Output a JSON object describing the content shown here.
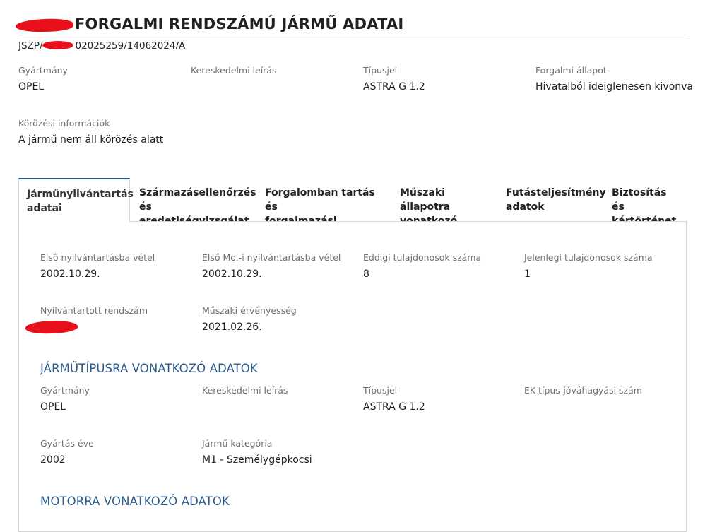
{
  "header": {
    "title": "FORGALMI RENDSZÁMÚ JÁRMŰ ADATAI",
    "ref_prefix": "JSZP/",
    "ref_suffix": "02025259/14062024/A"
  },
  "summary": [
    {
      "label": "Gyártmány",
      "value": "OPEL"
    },
    {
      "label": "Kereskedelmi leírás",
      "value": ""
    },
    {
      "label": "Típusjel",
      "value": "ASTRA G 1.2"
    },
    {
      "label": "Forgalmi állapot",
      "value": "Hivatalból ideiglenesen kivonva"
    },
    {
      "label": "Körözési információk",
      "value": "A jármű nem áll körözés alatt"
    }
  ],
  "tabs": [
    {
      "line1": "Járműnyilvántartás",
      "line2": "adatai",
      "active": true
    },
    {
      "line1": "Származásellenőrzés",
      "line2": "és eredetiségvizsgálat",
      "active": false
    },
    {
      "line1": "Forgalomban tartás és",
      "line2": "forgalmazási korlátozás",
      "active": false
    },
    {
      "line1": "Műszaki állapotra",
      "line2": "vonatkozó adatok",
      "active": false
    },
    {
      "line1": "Futásteljesítmény",
      "line2": "adatok",
      "active": false
    },
    {
      "line1": "Biztosítás és",
      "line2": "kártörténet",
      "active": false
    }
  ],
  "registry": [
    {
      "label": "Első nyilvántartásba vétel",
      "value": "2002.10.29."
    },
    {
      "label": "Első Mo.-i nyilvántartásba vétel",
      "value": "2002.10.29."
    },
    {
      "label": "Eddigi tulajdonosok száma",
      "value": "8"
    },
    {
      "label": "Jelenlegi tulajdonosok száma",
      "value": "1"
    },
    {
      "label": "Nyilvántartott rendszám",
      "value": ""
    },
    {
      "label": "Műszaki érvényesség",
      "value": "2021.02.26."
    }
  ],
  "type_section": {
    "heading": "JÁRMŰTÍPUSRA VONATKOZÓ ADATOK",
    "fields": [
      {
        "label": "Gyártmány",
        "value": "OPEL"
      },
      {
        "label": "Kereskedelmi leírás",
        "value": ""
      },
      {
        "label": "Típusjel",
        "value": "ASTRA G 1.2"
      },
      {
        "label": "EK típus-jóváhagyási szám",
        "value": ""
      },
      {
        "label": "Gyártás éve",
        "value": "2002"
      },
      {
        "label": "Jármű kategória",
        "value": "M1 - Személygépkocsi"
      }
    ]
  },
  "engine_section": {
    "heading": "MOTORRA VONATKOZÓ ADATOK"
  },
  "colors": {
    "accent": "#2a5b8c",
    "redaction": "#e8101b",
    "label": "#6f6f6f"
  }
}
